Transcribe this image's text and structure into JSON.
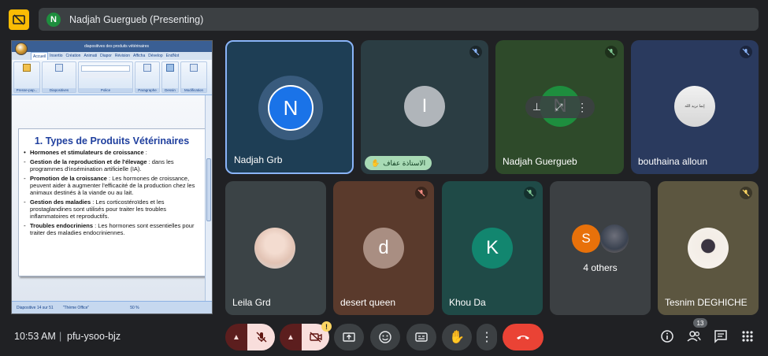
{
  "header": {
    "presenter_initial": "N",
    "presenter_label": "Nadjah Guergueb (Presenting)"
  },
  "presentation": {
    "window_title": "diapositives des produits vétérinaires",
    "tabs": [
      "Accueil",
      "Insertio",
      "Création",
      "Animati",
      "Diapor",
      "Révision",
      "Afficha",
      "Dévelop",
      "EndNot"
    ],
    "ribbon_groups": [
      "Presse-pap...",
      "Diapositives",
      "Police",
      "Paragraphe",
      "Dessin",
      "Modification"
    ],
    "slide_title": "1. Types de Produits Vétérinaires",
    "slide_lines": [
      {
        "type": "bullet",
        "bold": "Hormones et stimulateurs de croissance",
        "text": " :"
      },
      {
        "type": "sub",
        "bold": "Gestion de la reproduction et de l'élevage",
        "text": " : dans les programmes d'insémination artificielle (IA)."
      },
      {
        "type": "sub",
        "bold": "Promotion de la croissance",
        "text": " : Les hormones de croissance, peuvent aider à augmenter l'efficacité de la production chez les animaux destinés à la viande ou au lait."
      },
      {
        "type": "sub",
        "bold": "Gestion des maladies",
        "text": " : Les corticostéroïdes et les prostaglandines sont utilisés pour traiter les troubles inflammatoires et reproductifs."
      },
      {
        "type": "sub",
        "bold": "Troubles endocriniens",
        "text": " : Les hormones sont essentielles pour traiter des maladies endocriniennes."
      }
    ],
    "status_slide": "Diapositive 14 sur 51",
    "status_theme": "\"Thème Office\"",
    "status_zoom": "50 %"
  },
  "tiles": [
    {
      "id": "nadjah-grb",
      "name": "Nadjah Grb",
      "initial": "N"
    },
    {
      "id": "arabic-user",
      "name": "",
      "initial": "I",
      "caption": "الاستاذة عفاف"
    },
    {
      "id": "nadjah-guergueb",
      "name": "Nadjah Guergueb",
      "initial": "N"
    },
    {
      "id": "bouthaina",
      "name": "bouthaina alloun",
      "avatar_text": "إنما نريد الله"
    },
    {
      "id": "leila",
      "name": "Leila Grd"
    },
    {
      "id": "desert-queen",
      "name": "desert queen",
      "initial": "d"
    },
    {
      "id": "khou-da",
      "name": "Khou Da",
      "initial": "K"
    },
    {
      "id": "others",
      "name": "4 others",
      "initial": "S"
    },
    {
      "id": "tesnim",
      "name": "Tesnim DEGHICHE"
    }
  ],
  "bottom": {
    "time": "10:53 AM",
    "separator": "|",
    "meeting_code": "pfu-ysoo-bjz",
    "people_count": "13",
    "camera_warning": "!"
  },
  "colors": {
    "accent_blue": "#1a73e8",
    "warning_yellow": "#fbbc04",
    "end_call_red": "#ea4335"
  }
}
